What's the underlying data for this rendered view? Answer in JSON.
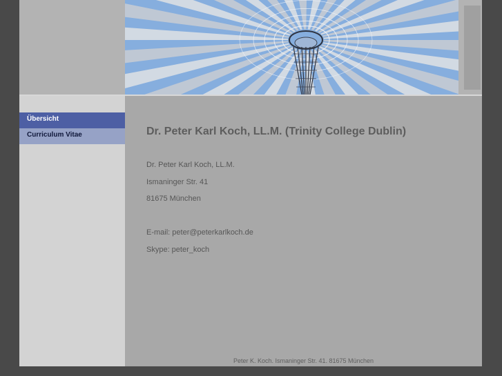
{
  "nav": {
    "items": [
      {
        "label": "Übersicht",
        "active": true
      },
      {
        "label": "Curriculum Vitae",
        "active": false
      }
    ]
  },
  "main": {
    "title": "Dr. Peter Karl Koch, LL.M. (Trinity College Dublin)",
    "name": "Dr. Peter Karl Koch, LL.M.",
    "street": "Ismaninger Str. 41",
    "city": "81675 München",
    "email": "E-mail: peter@peterkarlkoch.de",
    "skype": "Skype: peter_koch"
  },
  "footer": {
    "text": "Peter K. Koch. Ismaninger Str. 41. 81675 München"
  },
  "colors": {
    "background": "#494949",
    "page": "#a8a8a8",
    "sidebar": "#d3d3d3",
    "nav_active": "#4d5fa4",
    "nav_normal": "#96a2c6"
  }
}
